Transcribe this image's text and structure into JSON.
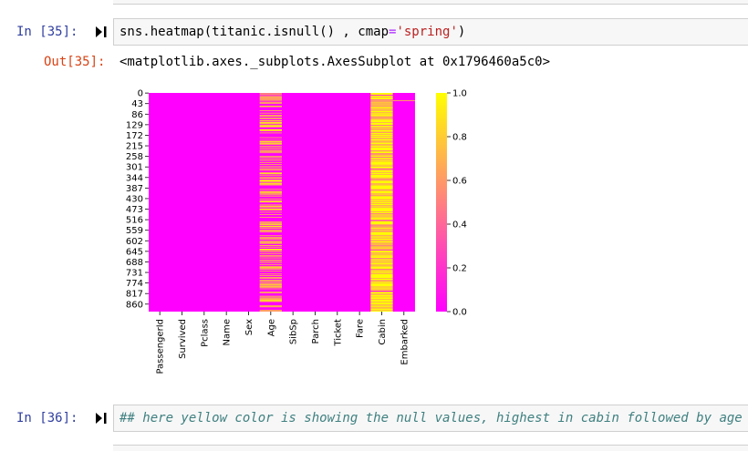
{
  "cell35": {
    "in_prompt": "In [35]:",
    "code_pre": "sns.heatmap(titanic.isnull() , cmap",
    "code_op": "=",
    "code_str": "'spring'",
    "code_post": ")",
    "out_prompt": "Out[35]:",
    "output_text": "<matplotlib.axes._subplots.AxesSubplot at 0x1796460a5c0>"
  },
  "cell36": {
    "in_prompt": "In [36]:",
    "code": "## here yellow color is showing the null values, highest in cabin followed by age"
  },
  "colors": {
    "low": "#ff00ff",
    "high": "#ffff00",
    "prompt_in": "#303f9f",
    "prompt_out": "#d84315"
  },
  "chart_data": {
    "type": "heatmap",
    "colormap": "spring",
    "columns": [
      "PassengerId",
      "Survived",
      "Pclass",
      "Name",
      "Sex",
      "Age",
      "SibSp",
      "Parch",
      "Ticket",
      "Fare",
      "Cabin",
      "Embarked"
    ],
    "row_tick_labels": [
      "0",
      "43",
      "86",
      "129",
      "172",
      "215",
      "258",
      "301",
      "344",
      "387",
      "430",
      "473",
      "516",
      "559",
      "602",
      "645",
      "688",
      "731",
      "774",
      "817",
      "860"
    ],
    "colorbar_ticks": [
      "0.0",
      "0.2",
      "0.4",
      "0.6",
      "0.8",
      "1.0"
    ],
    "colorbar_range": [
      0,
      1
    ],
    "n_rows": 891,
    "null_fraction": {
      "PassengerId": 0,
      "Survived": 0,
      "Pclass": 0,
      "Name": 0,
      "Sex": 0,
      "Age": 0.2,
      "SibSp": 0,
      "Parch": 0,
      "Ticket": 0,
      "Fare": 0,
      "Cabin": 0.77,
      "Embarked": 0.002
    }
  }
}
